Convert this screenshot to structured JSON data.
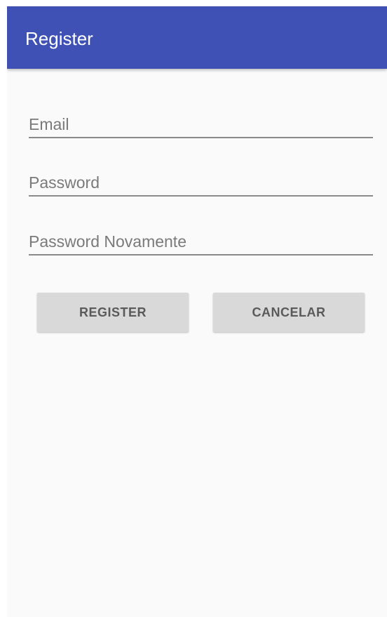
{
  "app_bar": {
    "title": "Register",
    "color": "#3f51b5"
  },
  "form": {
    "email": {
      "placeholder": "Email",
      "value": ""
    },
    "password": {
      "placeholder": "Password",
      "value": ""
    },
    "password_again": {
      "placeholder": "Password Novamente",
      "value": ""
    }
  },
  "buttons": {
    "register_label": "REGISTER",
    "cancel_label": "CANCELAR"
  }
}
